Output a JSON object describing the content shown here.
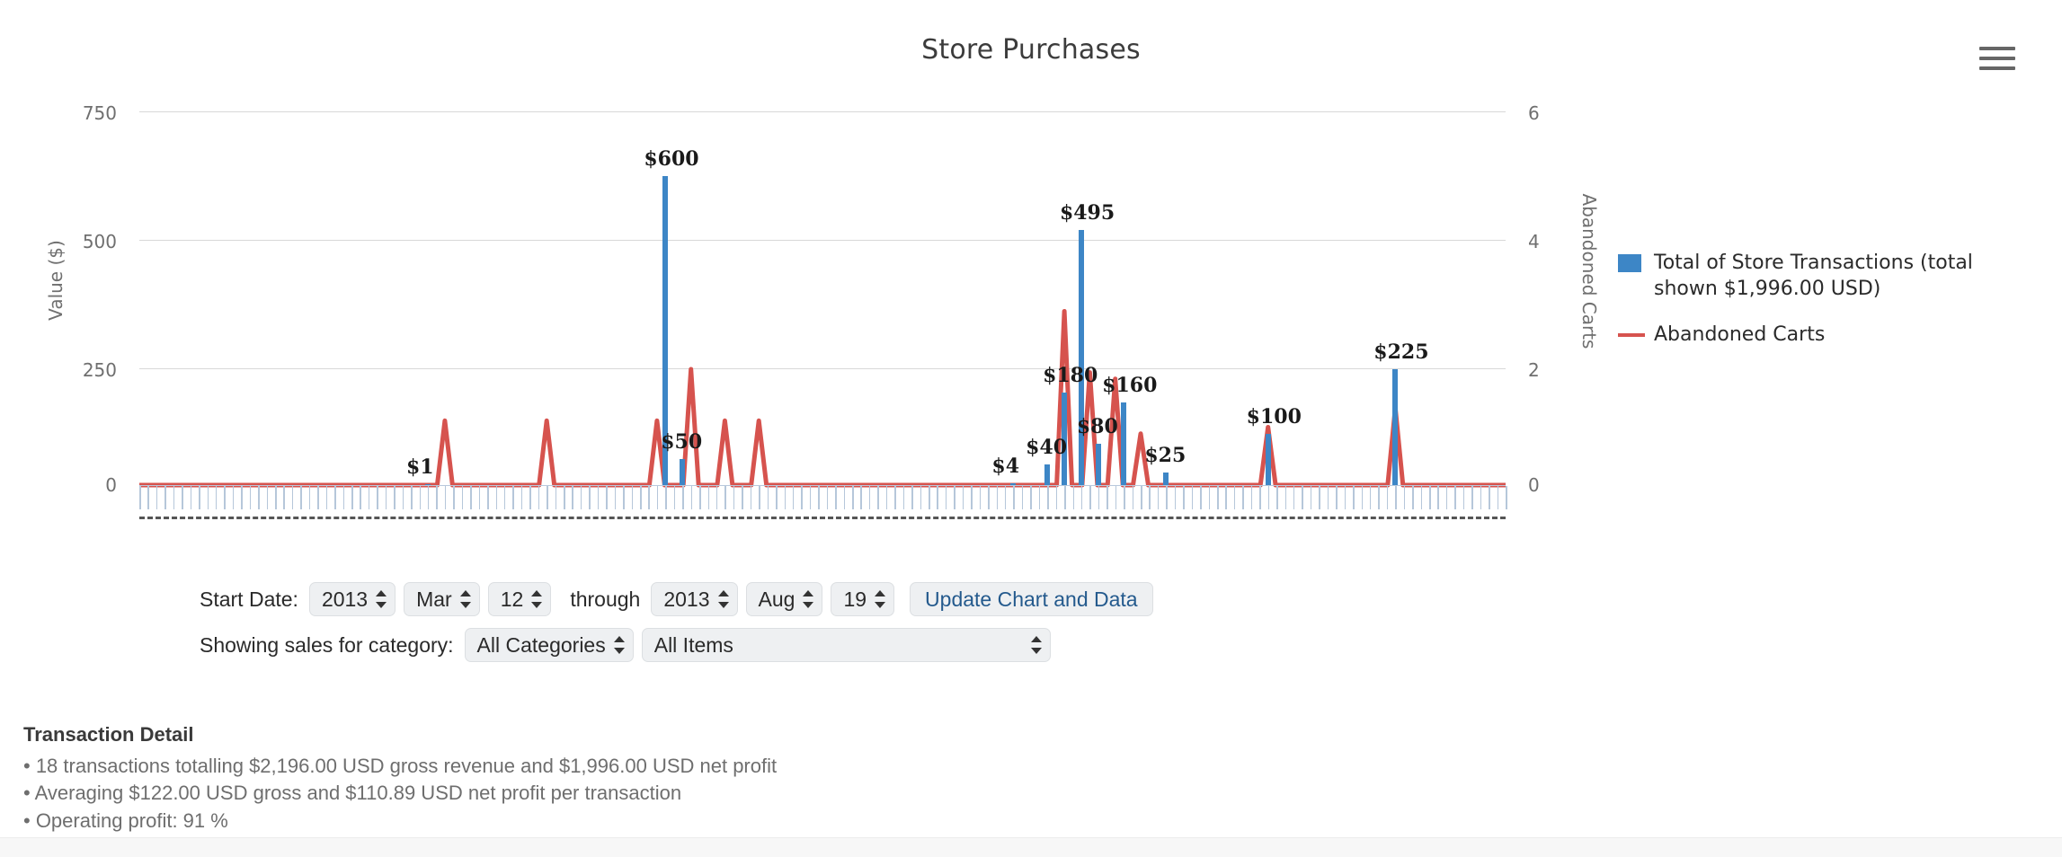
{
  "chart": {
    "title": "Store Purchases",
    "menu_icon": "hamburger-icon",
    "y_left_title": "Value ($)",
    "y_right_title": "Abandoned Carts",
    "y_left_ticks": [
      "750",
      "500",
      "250",
      "0"
    ],
    "y_right_ticks": [
      "6",
      "4",
      "2",
      "0"
    ],
    "legend": [
      {
        "swatch": "box",
        "color": "#3d86c6",
        "label": "Total of Store Transactions (total shown $1,996.00 USD)"
      },
      {
        "swatch": "line",
        "color": "#d6534e",
        "label": "Abandoned Carts"
      }
    ]
  },
  "chart_data": {
    "type": "bar",
    "title": "Store Purchases",
    "xlabel": "",
    "ylabel": "Value ($)",
    "y2label": "Abandoned Carts",
    "ylim": [
      0,
      750
    ],
    "y2lim": [
      0,
      6
    ],
    "yticks": [
      0,
      250,
      500,
      750
    ],
    "y2ticks": [
      0,
      2,
      4,
      6
    ],
    "grid": true,
    "legend_position": "right",
    "x_count": 161,
    "series": [
      {
        "name": "Total of Store Transactions (total shown $1,996.00 USD)",
        "type": "bar",
        "color": "#3d86c6",
        "axis": "left",
        "points": [
          {
            "x": 62,
            "value": 600,
            "label": "$600"
          },
          {
            "x": 64,
            "value": 50,
            "label": "$50"
          },
          {
            "x": 34,
            "value": 1,
            "label": "$1"
          },
          {
            "x": 103,
            "value": 4,
            "label": "$4"
          },
          {
            "x": 107,
            "value": 40,
            "label": "$40"
          },
          {
            "x": 109,
            "value": 180,
            "label": "$180"
          },
          {
            "x": 111,
            "value": 495,
            "label": "$495"
          },
          {
            "x": 113,
            "value": 80,
            "label": "$80"
          },
          {
            "x": 116,
            "value": 160,
            "label": "$160"
          },
          {
            "x": 121,
            "value": 25,
            "label": "$25"
          },
          {
            "x": 133,
            "value": 100,
            "label": "$100"
          },
          {
            "x": 148,
            "value": 225,
            "label": "$225"
          }
        ]
      },
      {
        "name": "Abandoned Carts",
        "type": "line",
        "color": "#d6534e",
        "axis": "right",
        "peaks": [
          {
            "x": 36,
            "value": 1
          },
          {
            "x": 48,
            "value": 1
          },
          {
            "x": 61,
            "value": 1
          },
          {
            "x": 65,
            "value": 1.8
          },
          {
            "x": 69,
            "value": 1
          },
          {
            "x": 73,
            "value": 1
          },
          {
            "x": 109,
            "value": 2.7
          },
          {
            "x": 112,
            "value": 1.75
          },
          {
            "x": 115,
            "value": 1.65
          },
          {
            "x": 118,
            "value": 0.8
          },
          {
            "x": 133,
            "value": 0.9
          },
          {
            "x": 148,
            "value": 1.2
          }
        ]
      }
    ]
  },
  "controls": {
    "start_label": "Start Date:",
    "start_year": "2013",
    "start_month": "Mar",
    "start_day": "12",
    "through_label": "through",
    "end_year": "2013",
    "end_month": "Aug",
    "end_day": "19",
    "update_label": "Update Chart and Data",
    "category_label": "Showing sales for category:",
    "category_value": "All Categories",
    "items_value": "All Items"
  },
  "detail": {
    "title": "Transaction Detail",
    "lines": [
      "• 18 transactions totalling $2,196.00 USD gross revenue and $1,996.00 USD net profit",
      "• Averaging $122.00 USD gross and $110.89 USD net profit per transaction",
      "• Operating profit: 91 %"
    ]
  }
}
